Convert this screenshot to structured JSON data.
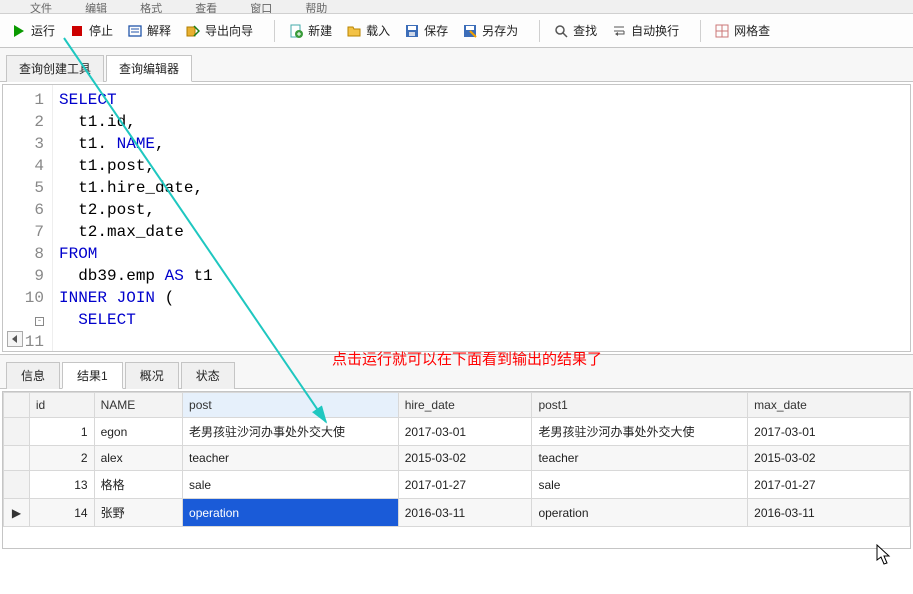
{
  "menubar": {
    "items": [
      "文件",
      "编辑",
      "格式",
      "查看",
      "窗口",
      "帮助"
    ]
  },
  "toolbar": {
    "run": {
      "label": "运行"
    },
    "stop": {
      "label": "停止"
    },
    "explain": {
      "label": "解释"
    },
    "export_wizard": {
      "label": "导出向导"
    },
    "new": {
      "label": "新建"
    },
    "load": {
      "label": "载入"
    },
    "save": {
      "label": "保存"
    },
    "save_as": {
      "label": "另存为"
    },
    "find": {
      "label": "查找"
    },
    "wrap": {
      "label": "自动换行"
    },
    "grid": {
      "label": "网格查"
    }
  },
  "main_tabs": {
    "builder": "查询创建工具",
    "editor": "查询编辑器"
  },
  "sql": {
    "lines": [
      {
        "n": "1",
        "fold": "",
        "tok": [
          [
            "kw",
            "SELECT"
          ]
        ]
      },
      {
        "n": "2",
        "fold": "",
        "tok": [
          [
            "sp",
            "  "
          ],
          [
            "ident",
            "t1"
          ],
          [
            "op",
            "."
          ],
          [
            "ident",
            "id"
          ],
          [
            "op",
            ","
          ]
        ]
      },
      {
        "n": "3",
        "fold": "",
        "tok": [
          [
            "sp",
            "  "
          ],
          [
            "ident",
            "t1"
          ],
          [
            "op",
            ". "
          ],
          [
            "kw",
            "NAME"
          ],
          [
            "op",
            ","
          ]
        ]
      },
      {
        "n": "4",
        "fold": "",
        "tok": [
          [
            "sp",
            "  "
          ],
          [
            "ident",
            "t1"
          ],
          [
            "op",
            "."
          ],
          [
            "ident",
            "post"
          ],
          [
            "op",
            ","
          ]
        ]
      },
      {
        "n": "5",
        "fold": "",
        "tok": [
          [
            "sp",
            "  "
          ],
          [
            "ident",
            "t1"
          ],
          [
            "op",
            "."
          ],
          [
            "ident",
            "hire_date"
          ],
          [
            "op",
            ","
          ]
        ]
      },
      {
        "n": "6",
        "fold": "",
        "tok": [
          [
            "sp",
            "  "
          ],
          [
            "ident",
            "t2"
          ],
          [
            "op",
            "."
          ],
          [
            "ident",
            "post"
          ],
          [
            "op",
            ","
          ]
        ]
      },
      {
        "n": "7",
        "fold": "",
        "tok": [
          [
            "sp",
            "  "
          ],
          [
            "ident",
            "t2"
          ],
          [
            "op",
            "."
          ],
          [
            "ident",
            "max_date"
          ]
        ]
      },
      {
        "n": "8",
        "fold": "",
        "tok": [
          [
            "kw",
            "FROM"
          ]
        ]
      },
      {
        "n": "9",
        "fold": "",
        "tok": [
          [
            "sp",
            "  "
          ],
          [
            "ident",
            "db39"
          ],
          [
            "op",
            "."
          ],
          [
            "ident",
            "emp"
          ],
          [
            "sp",
            " "
          ],
          [
            "kw",
            "AS"
          ],
          [
            "sp",
            " "
          ],
          [
            "ident",
            "t1"
          ]
        ]
      },
      {
        "n": "10",
        "fold": "⊟",
        "tok": [
          [
            "kw",
            "INNER"
          ],
          [
            "sp",
            " "
          ],
          [
            "kw",
            "JOIN"
          ],
          [
            "sp",
            " "
          ],
          [
            "op",
            "("
          ]
        ]
      },
      {
        "n": "11",
        "fold": "",
        "tok": [
          [
            "sp",
            "  "
          ],
          [
            "kw",
            "SELECT"
          ]
        ]
      }
    ]
  },
  "annotation": "点击运行就可以在下面看到输出的结果了",
  "result_tabs": {
    "info": "信息",
    "result1": "结果1",
    "profile": "概况",
    "status": "状态"
  },
  "grid": {
    "cols": [
      "",
      "id",
      "NAME",
      "post",
      "hire_date",
      "post1",
      "max_date"
    ],
    "rows": [
      {
        "marker": "",
        "id": "1",
        "name": "egon",
        "post": "老男孩驻沙河办事处外交大使",
        "hire": "2017-03-01",
        "post1": "老男孩驻沙河办事处外交大使",
        "max": "2017-03-01"
      },
      {
        "marker": "",
        "id": "2",
        "name": "alex",
        "post": "teacher",
        "hire": "2015-03-02",
        "post1": "teacher",
        "max": "2015-03-02"
      },
      {
        "marker": "",
        "id": "13",
        "name": "格格",
        "post": "sale",
        "hire": "2017-01-27",
        "post1": "sale",
        "max": "2017-01-27"
      },
      {
        "marker": "▶",
        "id": "14",
        "name": "张野",
        "post": "operation",
        "hire": "2016-03-11",
        "post1": "operation",
        "max": "2016-03-11"
      }
    ],
    "selected_row": 3,
    "selected_col": "post"
  }
}
